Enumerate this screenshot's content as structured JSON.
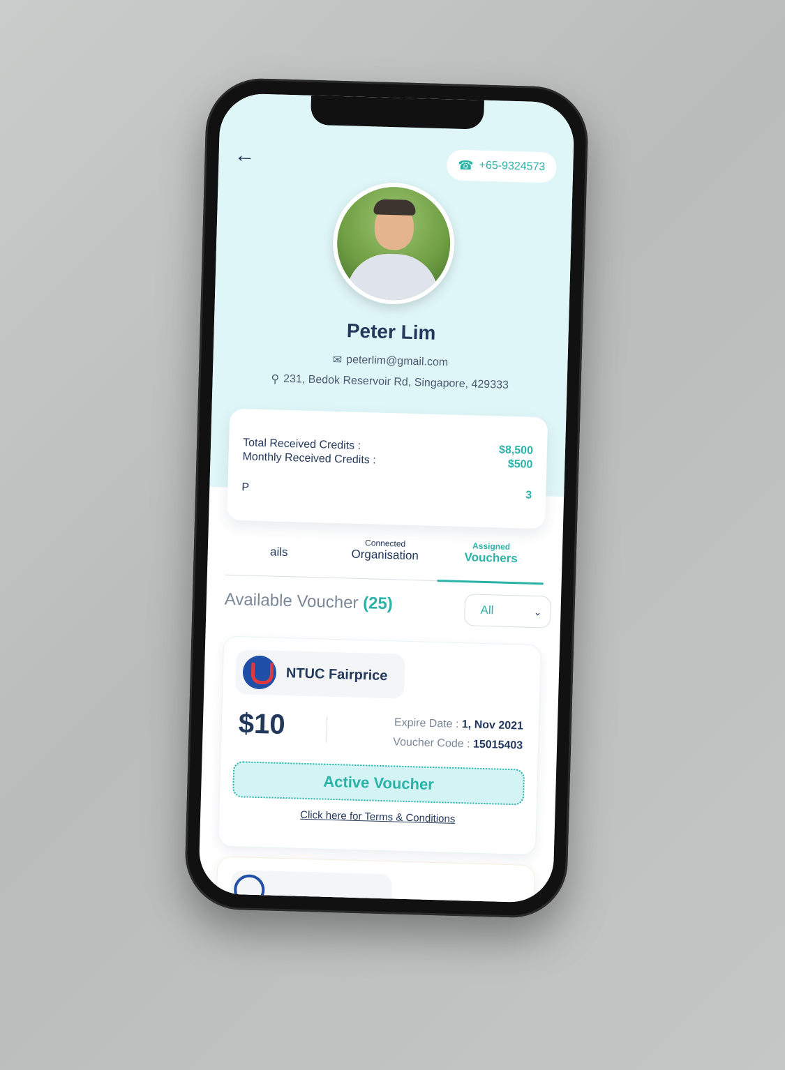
{
  "contact": {
    "phone": "+65-9324573"
  },
  "profile": {
    "name": "Peter Lim",
    "email": "peterlim@gmail.com",
    "address": "231, Bedok Reservoir Rd, Singapore, 429333"
  },
  "credits": {
    "rows": [
      {
        "label": "Total Received Credits :",
        "value": "$8,500"
      },
      {
        "label": "Monthly Received Credits :",
        "value": "$500"
      },
      {
        "label": "P",
        "value": "3"
      }
    ]
  },
  "tabs": [
    {
      "small": "",
      "big": "ails",
      "active": false
    },
    {
      "small": "Connected",
      "big": "Organisation",
      "active": false
    },
    {
      "small": "Assigned",
      "big": "Vouchers",
      "active": true
    }
  ],
  "vouchers_section": {
    "title": "Available Voucher",
    "count": "(25)",
    "filter_value": "All"
  },
  "voucher": {
    "merchant": "NTUC Fairprice",
    "amount": "$10",
    "expire_label": "Expire Date :",
    "expire_value": "1, Nov 2021",
    "code_label": "Voucher Code :",
    "code_value": "15015403",
    "status_button": "Active Voucher",
    "terms_link": "Click here for Terms & Conditions"
  },
  "colors": {
    "accent": "#2bb3a8",
    "navy": "#23395b",
    "header_bg": "#dff6f8",
    "active_fill": "#d4f3f5"
  },
  "icons": {
    "back": "arrow-left-icon",
    "phone": "phone-icon",
    "email": "mail-icon",
    "location": "location-pin-icon",
    "dropdown": "chevron-down-icon"
  }
}
